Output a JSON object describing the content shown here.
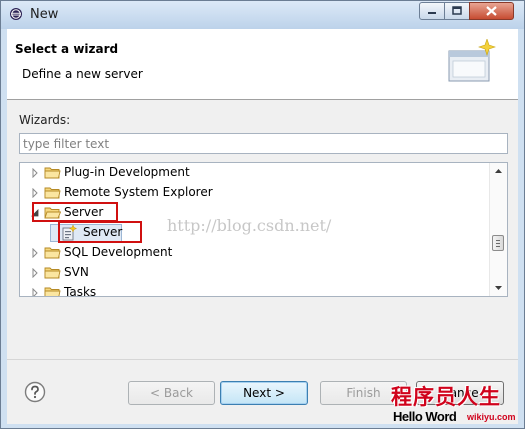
{
  "window": {
    "title": "New",
    "icon": "eclipse-icon"
  },
  "header": {
    "title": "Select a wizard",
    "description": "Define a new server",
    "image_icon": "new-wizard-banner-icon"
  },
  "wizards": {
    "label": "Wizards:",
    "filter_placeholder": "type filter text",
    "tree": [
      {
        "label": "Plug-in Development",
        "type": "folder",
        "expanded": false,
        "level": 0
      },
      {
        "label": "Remote System Explorer",
        "type": "folder",
        "expanded": false,
        "level": 0
      },
      {
        "label": "Server",
        "type": "folder",
        "expanded": true,
        "level": 0,
        "highlighted": true
      },
      {
        "label": "Server",
        "type": "wizard",
        "level": 1,
        "selected": true,
        "highlighted": true
      },
      {
        "label": "SQL Development",
        "type": "folder",
        "expanded": false,
        "level": 0
      },
      {
        "label": "SVN",
        "type": "folder",
        "expanded": false,
        "level": 0
      },
      {
        "label": "Tasks",
        "type": "folder",
        "expanded": false,
        "level": 0
      }
    ]
  },
  "watermark": "http://blog.csdn.net/",
  "buttons": {
    "back": "< Back",
    "next": "Next >",
    "finish": "Finish",
    "cancel": "Cance"
  },
  "brand": {
    "chinese": "程序员人生",
    "english": "Hello Word",
    "url": "wikiyu.com"
  },
  "colors": {
    "highlight_box": "#d01010",
    "brand_red": "#d0021b",
    "selection": "#dfe9f5"
  }
}
